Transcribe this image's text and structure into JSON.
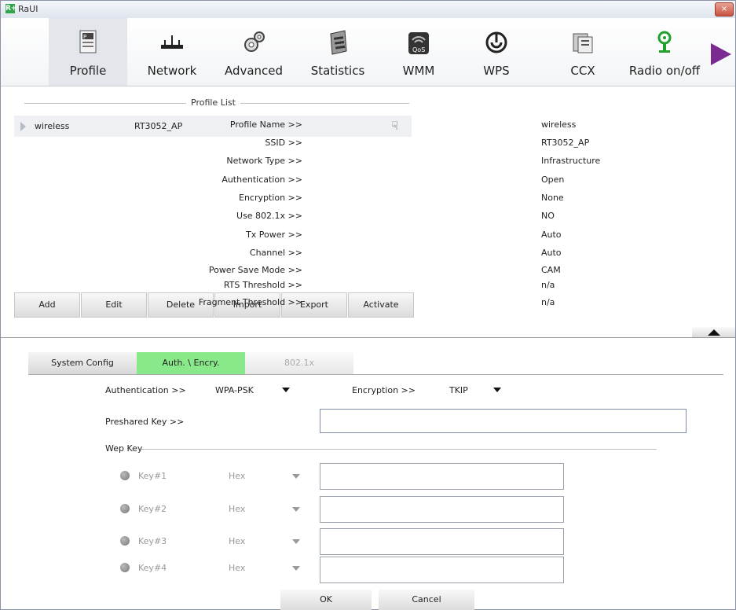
{
  "window": {
    "title": "RaUI",
    "logo": "R+",
    "close_symbol": "×"
  },
  "toolbar": {
    "items": [
      {
        "label": "Profile",
        "icon": "profile-icon",
        "active": true
      },
      {
        "label": "Network",
        "icon": "network-icon"
      },
      {
        "label": "Advanced",
        "icon": "gears-icon"
      },
      {
        "label": "Statistics",
        "icon": "statistics-icon"
      },
      {
        "label": "WMM",
        "icon": "wmm-icon"
      },
      {
        "label": "WPS",
        "icon": "wps-icon"
      },
      {
        "label": "CCX",
        "icon": "ccx-icon"
      },
      {
        "label": "Radio on/off",
        "icon": "radio-icon"
      }
    ],
    "wmm_badge": "QoS"
  },
  "profile_list": {
    "legend": "Profile List",
    "rows": [
      {
        "name": "wireless",
        "ssid": "RT3052_AP"
      }
    ],
    "buttons": [
      "Add",
      "Edit",
      "Delete",
      "Import",
      "Export",
      "Activate"
    ]
  },
  "profile_info": [
    {
      "key": "Profile Name >>",
      "value": "wireless"
    },
    {
      "key": "SSID >>",
      "value": "RT3052_AP"
    },
    {
      "key": "Network Type >>",
      "value": "Infrastructure"
    },
    {
      "key": "Authentication >>",
      "value": "Open"
    },
    {
      "key": "Encryption >>",
      "value": "None"
    },
    {
      "key": "Use 802.1x >>",
      "value": "NO"
    },
    {
      "key": "Tx Power >>",
      "value": "Auto"
    },
    {
      "key": "Channel >>",
      "value": "Auto"
    },
    {
      "key": "Power Save Mode >>",
      "value": "CAM"
    },
    {
      "key": "RTS Threshold >>",
      "value": "n/a"
    },
    {
      "key": "Fragment Threshold >>",
      "value": "n/a"
    }
  ],
  "tabs": [
    "System Config",
    "Auth. \\ Encry.",
    "802.1x"
  ],
  "auth_form": {
    "auth_label": "Authentication >>",
    "auth_value": "WPA-PSK",
    "enc_label": "Encryption >>",
    "enc_value": "TKIP",
    "psk_label": "Preshared Key >>",
    "psk_value": "",
    "wep_legend": "Wep Key",
    "wep_keys": [
      {
        "label": "Key#1",
        "format": "Hex",
        "value": ""
      },
      {
        "label": "Key#2",
        "format": "Hex",
        "value": ""
      },
      {
        "label": "Key#3",
        "format": "Hex",
        "value": ""
      },
      {
        "label": "Key#4",
        "format": "Hex",
        "value": ""
      }
    ]
  },
  "dialog_buttons": {
    "ok": "OK",
    "cancel": "Cancel"
  },
  "colors": {
    "active_tab": "#89e889",
    "arrow": "#7a2a91"
  }
}
